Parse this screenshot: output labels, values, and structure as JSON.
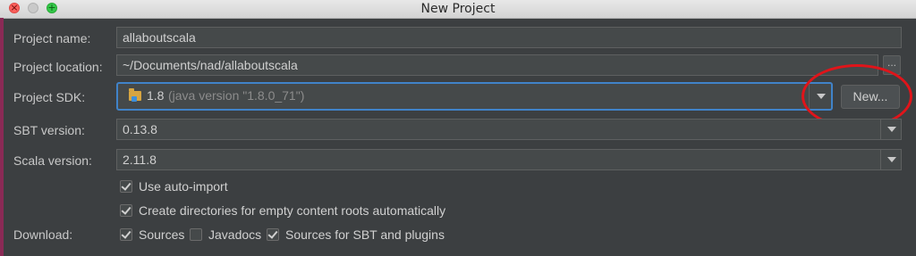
{
  "window": {
    "title": "New Project"
  },
  "form": {
    "project_name_label": "Project name:",
    "project_name_value": "allaboutscala",
    "project_location_label": "Project location:",
    "project_location_value": "~/Documents/nad/allaboutscala",
    "browse_label": "...",
    "project_sdk_label": "Project SDK:",
    "sdk_version": "1.8",
    "sdk_detail": "(java version \"1.8.0_71\")",
    "new_button": "New...",
    "sbt_version_label": "SBT version:",
    "sbt_version_value": "0.13.8",
    "scala_version_label": "Scala version:",
    "scala_version_value": "2.11.8"
  },
  "options": {
    "auto_import": {
      "label": "Use auto-import",
      "checked": true
    },
    "create_dirs": {
      "label": "Create directories for empty content roots automatically",
      "checked": true
    }
  },
  "download": {
    "label": "Download:",
    "sources": {
      "label": "Sources",
      "checked": true
    },
    "javadocs": {
      "label": "Javadocs",
      "checked": false
    },
    "sbt_sources": {
      "label": "Sources for SBT and plugins",
      "checked": true
    }
  },
  "colors": {
    "background": "#3c3f41",
    "focus": "#4083c9",
    "annotation_ring": "#e0141a"
  }
}
